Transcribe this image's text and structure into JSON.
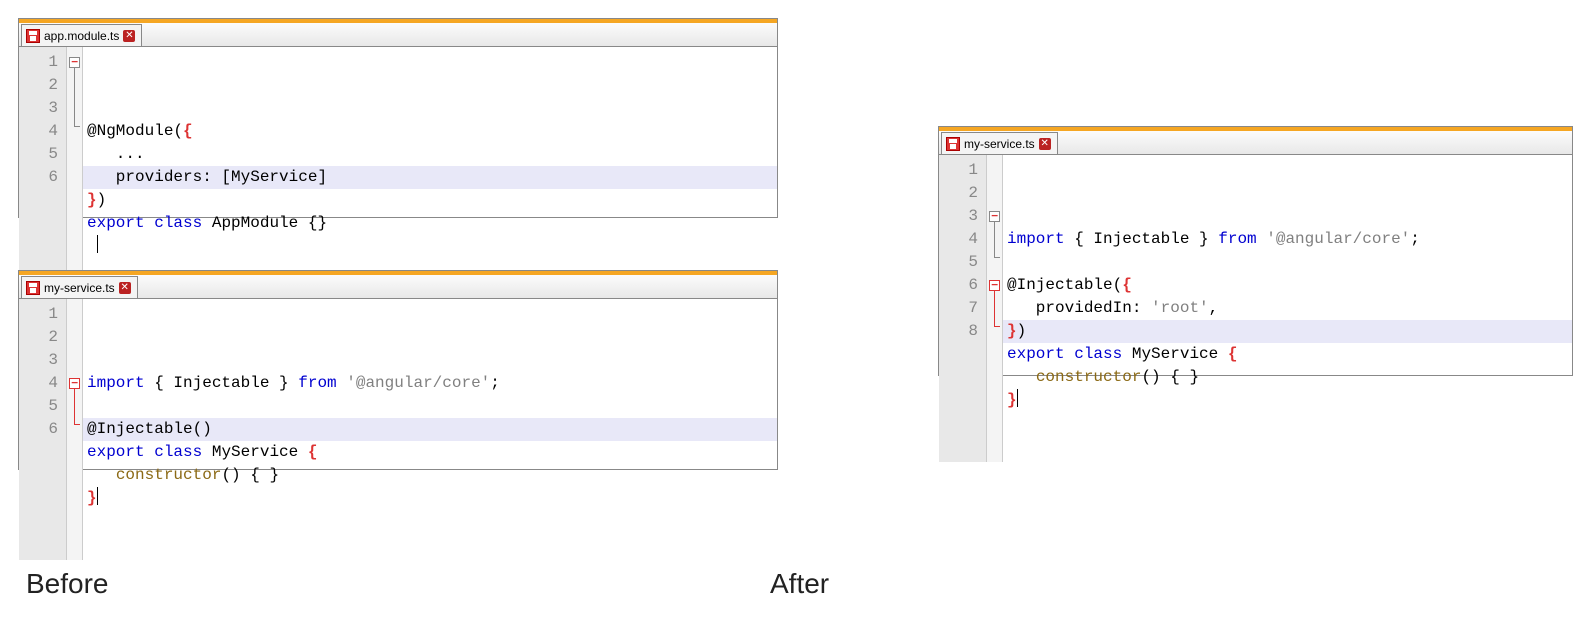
{
  "labels": {
    "before": "Before",
    "after": "After"
  },
  "panels": {
    "before_top": {
      "tab_name": "app.module.ts",
      "line_numbers": [
        "1",
        "2",
        "3",
        "4",
        "5",
        "6"
      ],
      "lines": [
        {
          "seg": [
            {
              "c": "fn",
              "t": "@NgModule"
            },
            {
              "c": "",
              "t": "("
            },
            {
              "c": "br-r",
              "t": "{"
            }
          ]
        },
        {
          "seg": [
            {
              "c": "",
              "t": "   ..."
            }
          ]
        },
        {
          "seg": [
            {
              "c": "",
              "t": "   providers: [MyService]"
            }
          ]
        },
        {
          "seg": [
            {
              "c": "br-r",
              "t": "}"
            },
            {
              "c": "",
              "t": ")"
            }
          ]
        },
        {
          "seg": [
            {
              "c": "kw",
              "t": "export"
            },
            {
              "c": "",
              "t": " "
            },
            {
              "c": "kw",
              "t": "class"
            },
            {
              "c": "cls",
              "t": " AppModule "
            },
            {
              "c": "",
              "t": "{}"
            }
          ]
        },
        {
          "seg": []
        }
      ],
      "highlight_row": 5
    },
    "before_bottom": {
      "tab_name": "my-service.ts",
      "line_numbers": [
        "1",
        "2",
        "3",
        "4",
        "5",
        "6"
      ],
      "lines": [
        {
          "seg": [
            {
              "c": "kw",
              "t": "import"
            },
            {
              "c": "",
              "t": " { Injectable } "
            },
            {
              "c": "kw",
              "t": "from"
            },
            {
              "c": "",
              "t": " "
            },
            {
              "c": "str",
              "t": "'@angular/core'"
            },
            {
              "c": "",
              "t": ";"
            }
          ]
        },
        {
          "seg": []
        },
        {
          "seg": [
            {
              "c": "fn",
              "t": "@Injectable"
            },
            {
              "c": "",
              "t": "()"
            }
          ]
        },
        {
          "seg": [
            {
              "c": "kw",
              "t": "export"
            },
            {
              "c": "",
              "t": " "
            },
            {
              "c": "kw",
              "t": "class"
            },
            {
              "c": "cls",
              "t": " MyService "
            },
            {
              "c": "br-r",
              "t": "{"
            }
          ]
        },
        {
          "seg": [
            {
              "c": "",
              "t": "   "
            },
            {
              "c": "ctor",
              "t": "constructor"
            },
            {
              "c": "",
              "t": "() { }"
            }
          ]
        },
        {
          "seg": [
            {
              "c": "br-r",
              "t": "}"
            }
          ]
        }
      ],
      "highlight_row": 5
    },
    "after": {
      "tab_name": "my-service.ts",
      "line_numbers": [
        "1",
        "2",
        "3",
        "4",
        "5",
        "6",
        "7",
        "8"
      ],
      "lines": [
        {
          "seg": [
            {
              "c": "kw",
              "t": "import"
            },
            {
              "c": "",
              "t": " { Injectable } "
            },
            {
              "c": "kw",
              "t": "from"
            },
            {
              "c": "",
              "t": " "
            },
            {
              "c": "str",
              "t": "'@angular/core'"
            },
            {
              "c": "",
              "t": ";"
            }
          ]
        },
        {
          "seg": []
        },
        {
          "seg": [
            {
              "c": "fn",
              "t": "@Injectable"
            },
            {
              "c": "",
              "t": "("
            },
            {
              "c": "br-r",
              "t": "{"
            }
          ]
        },
        {
          "seg": [
            {
              "c": "",
              "t": "   providedIn: "
            },
            {
              "c": "str",
              "t": "'root'"
            },
            {
              "c": "",
              "t": ","
            }
          ]
        },
        {
          "seg": [
            {
              "c": "br-r",
              "t": "}"
            },
            {
              "c": "",
              "t": ")"
            }
          ]
        },
        {
          "seg": [
            {
              "c": "kw",
              "t": "export"
            },
            {
              "c": "",
              "t": " "
            },
            {
              "c": "kw",
              "t": "class"
            },
            {
              "c": "cls",
              "t": " MyService "
            },
            {
              "c": "br-r",
              "t": "{"
            }
          ]
        },
        {
          "seg": [
            {
              "c": "",
              "t": "   "
            },
            {
              "c": "ctor",
              "t": "constructor"
            },
            {
              "c": "",
              "t": "() { }"
            }
          ]
        },
        {
          "seg": [
            {
              "c": "br-r",
              "t": "}"
            }
          ]
        }
      ],
      "highlight_row": 7
    }
  }
}
